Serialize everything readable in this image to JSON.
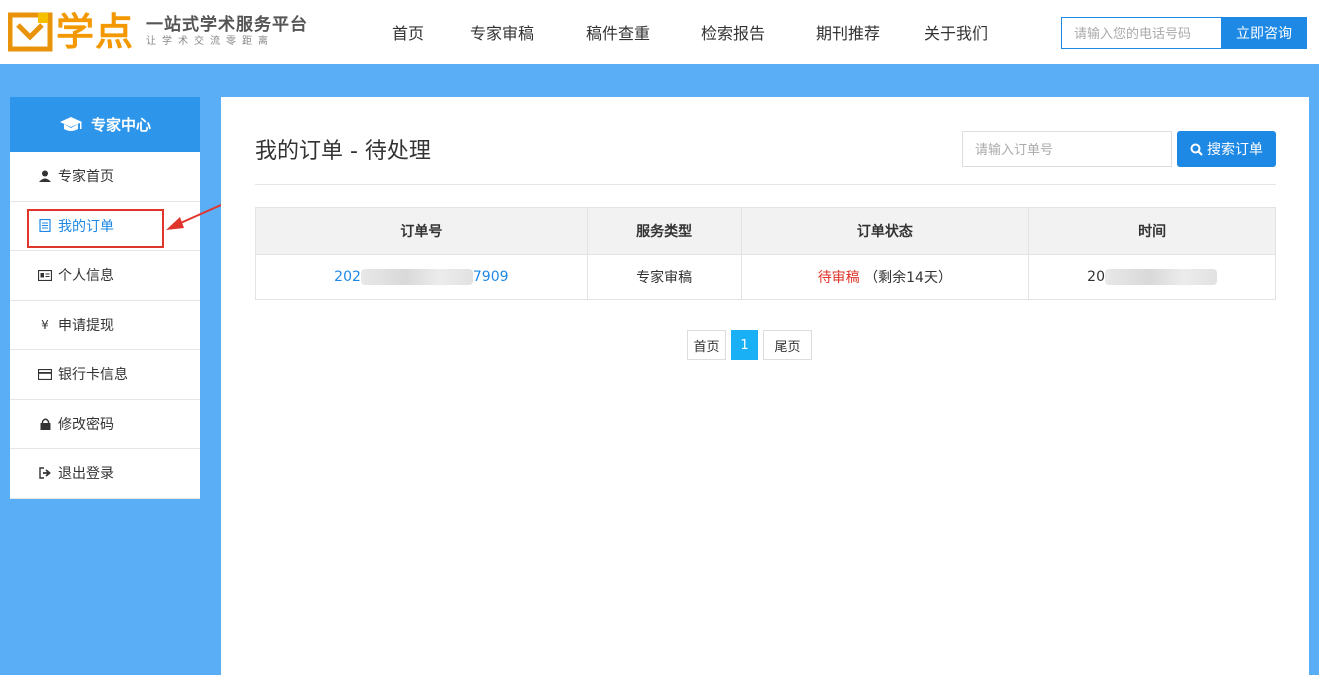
{
  "header": {
    "brand_name": "学点",
    "slogan": "一站式学术服务平台",
    "motto": "让学术交流零距离",
    "nav": [
      "首页",
      "专家审稿",
      "稿件查重",
      "检索报告",
      "期刊推荐",
      "关于我们"
    ],
    "phone_placeholder": "请输入您的电话号码",
    "consult_label": "立即咨询"
  },
  "sidebar": {
    "title": "专家中心",
    "items": [
      {
        "label": "专家首页",
        "icon": "user-icon"
      },
      {
        "label": "我的订单",
        "icon": "document-icon",
        "active": true
      },
      {
        "label": "个人信息",
        "icon": "id-card-icon"
      },
      {
        "label": "申请提现",
        "icon": "yen-icon"
      },
      {
        "label": "银行卡信息",
        "icon": "credit-card-icon"
      },
      {
        "label": "修改密码",
        "icon": "lock-icon"
      },
      {
        "label": "退出登录",
        "icon": "logout-icon"
      }
    ]
  },
  "main": {
    "title": "我的订单 - 待处理",
    "search_placeholder": "请输入订单号",
    "search_label": "搜索订单",
    "table": {
      "headers": [
        "订单号",
        "服务类型",
        "订单状态",
        "时间"
      ],
      "rows": [
        {
          "order_no_prefix": "202",
          "order_no_suffix": "7909",
          "service": "专家审稿",
          "status": "待审稿",
          "remaining": "（剩余14天）",
          "time_prefix": "20"
        }
      ]
    },
    "pager": {
      "first": "首页",
      "current": "1",
      "last": "尾页"
    }
  },
  "colors": {
    "page_bg": "#5aaef5",
    "primary": "#1e88e5",
    "sidebar_head": "#2e96ea",
    "brand_orange": "#f39800",
    "status_red": "#e0352b",
    "pager_active": "#1ab0f5"
  }
}
